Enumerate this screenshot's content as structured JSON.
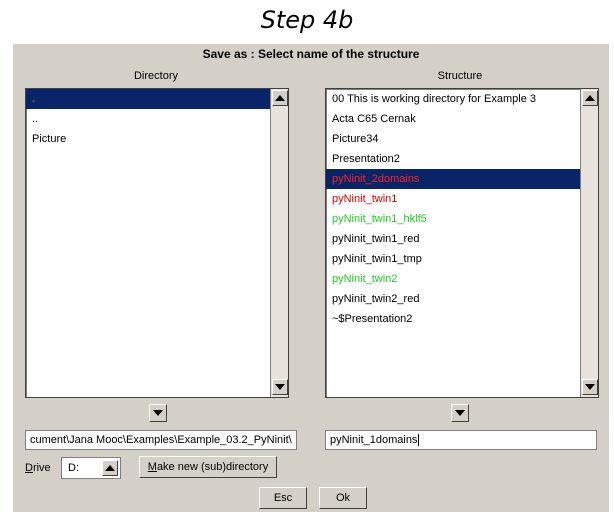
{
  "caption": "Step 4b",
  "dialog": {
    "title": "Save as : Select name of the structure",
    "directory": {
      "label": "Directory",
      "items": [
        {
          "text": ".",
          "color": "#ffffff",
          "selected": true
        },
        {
          "text": "..",
          "color": "#000000",
          "selected": false
        },
        {
          "text": "Picture",
          "color": "#000000",
          "selected": false
        }
      ],
      "path_value": "cument\\Jana Mooc\\Examples\\Example_03.2_PyNinit\\"
    },
    "structure": {
      "label": "Structure",
      "items": [
        {
          "text": "00 This is working directory for Example 3",
          "color": "#000000",
          "selected": false
        },
        {
          "text": "Acta C65 Cernak",
          "color": "#000000",
          "selected": false
        },
        {
          "text": "Picture34",
          "color": "#000000",
          "selected": false
        },
        {
          "text": "Presentation2",
          "color": "#000000",
          "selected": false
        },
        {
          "text": "pyNinit_2domains",
          "color": "#ff2020",
          "selected": true
        },
        {
          "text": "pyNinit_twin1",
          "color": "#e00000",
          "selected": false
        },
        {
          "text": "pyNinit_twin1_hklf5",
          "color": "#22cc22",
          "selected": false
        },
        {
          "text": "pyNinit_twin1_red",
          "color": "#000000",
          "selected": false
        },
        {
          "text": "pyNinit_twin1_tmp",
          "color": "#000000",
          "selected": false
        },
        {
          "text": "pyNinit_twin2",
          "color": "#22cc22",
          "selected": false
        },
        {
          "text": "pyNinit_twin2_red",
          "color": "#000000",
          "selected": false
        },
        {
          "text": "~$Presentation2",
          "color": "#000000",
          "selected": false
        }
      ],
      "name_value": "pyNinit_1domains"
    },
    "drive": {
      "label_prefix": "D",
      "label_rest": "rive",
      "value": "D:"
    },
    "make_dir_button": {
      "underlined": "M",
      "rest": "ake new (sub)directory"
    },
    "esc_label": "Esc",
    "ok_label": "Ok"
  }
}
